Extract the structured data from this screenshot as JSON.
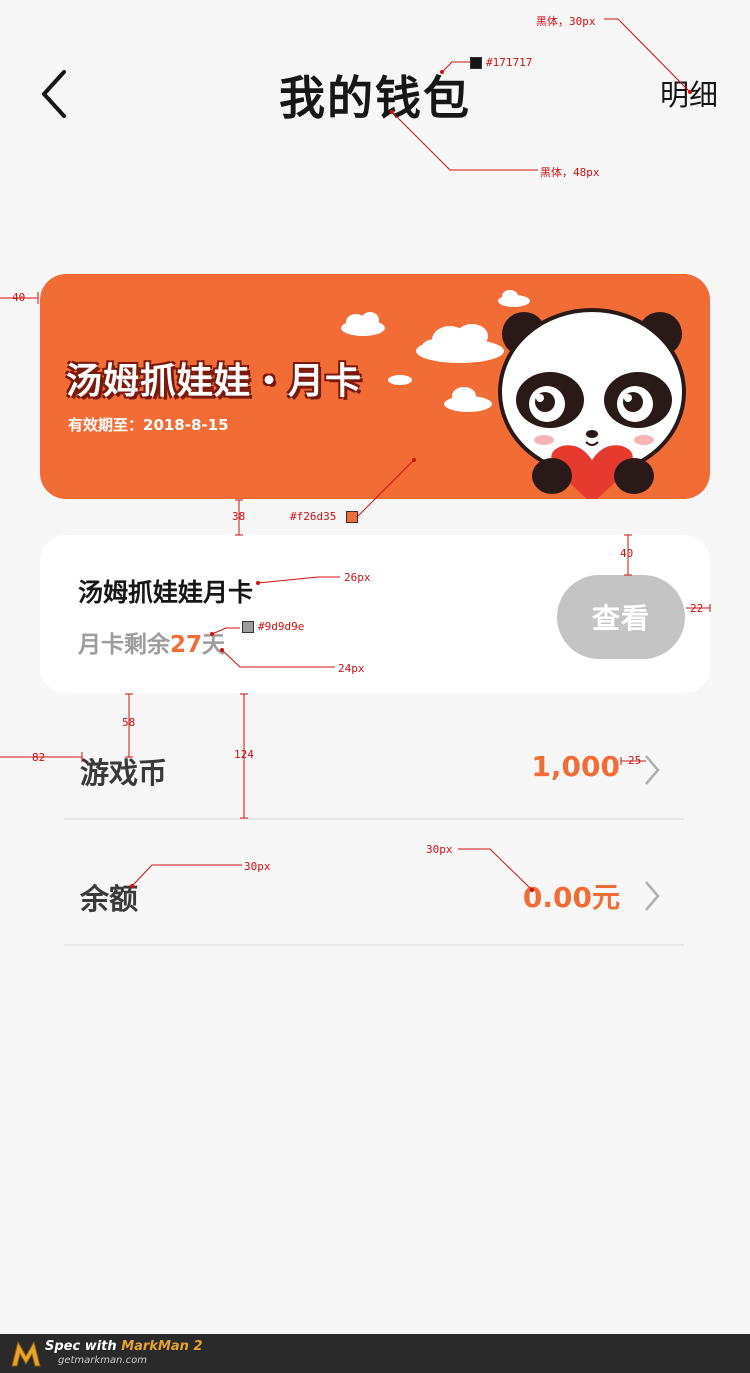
{
  "header": {
    "title": "我的钱包",
    "detail_label": "明细"
  },
  "banner": {
    "title": "汤姆抓娃娃・月卡",
    "validity": "有效期至：2018-8-15",
    "color": "#f26d35"
  },
  "card": {
    "name": "汤姆抓娃娃月卡",
    "remain_prefix": "月卡剩余",
    "remain_days": "27",
    "remain_suffix": "天",
    "view_button": "查看"
  },
  "rows": [
    {
      "label": "游戏币",
      "value": "1,000"
    },
    {
      "label": "余额",
      "value": "0.00元"
    }
  ],
  "annotations": {
    "detail_font": "黑体，30px",
    "title_color": "#171717",
    "title_font": "黑体，48px",
    "banner_left": "40",
    "banner_color": "#f26d35",
    "gap_38": "38",
    "gap_40": "40",
    "btn_right": "22",
    "card_name_font": "26px",
    "gray_color": "#9d9d9e",
    "remain_font": "24px",
    "gap_58": "58",
    "row_height": "124",
    "row_left": "82",
    "chev_gap": "25",
    "balance_label_font": "30px",
    "balance_value_font": "30px"
  },
  "footer": {
    "spec_prefix": "Spec with ",
    "brand": "MarkMan 2",
    "site": "getmarkman.com"
  },
  "colors": {
    "accent": "#f26d35",
    "text": "#171717",
    "muted": "#9d9d9e"
  }
}
